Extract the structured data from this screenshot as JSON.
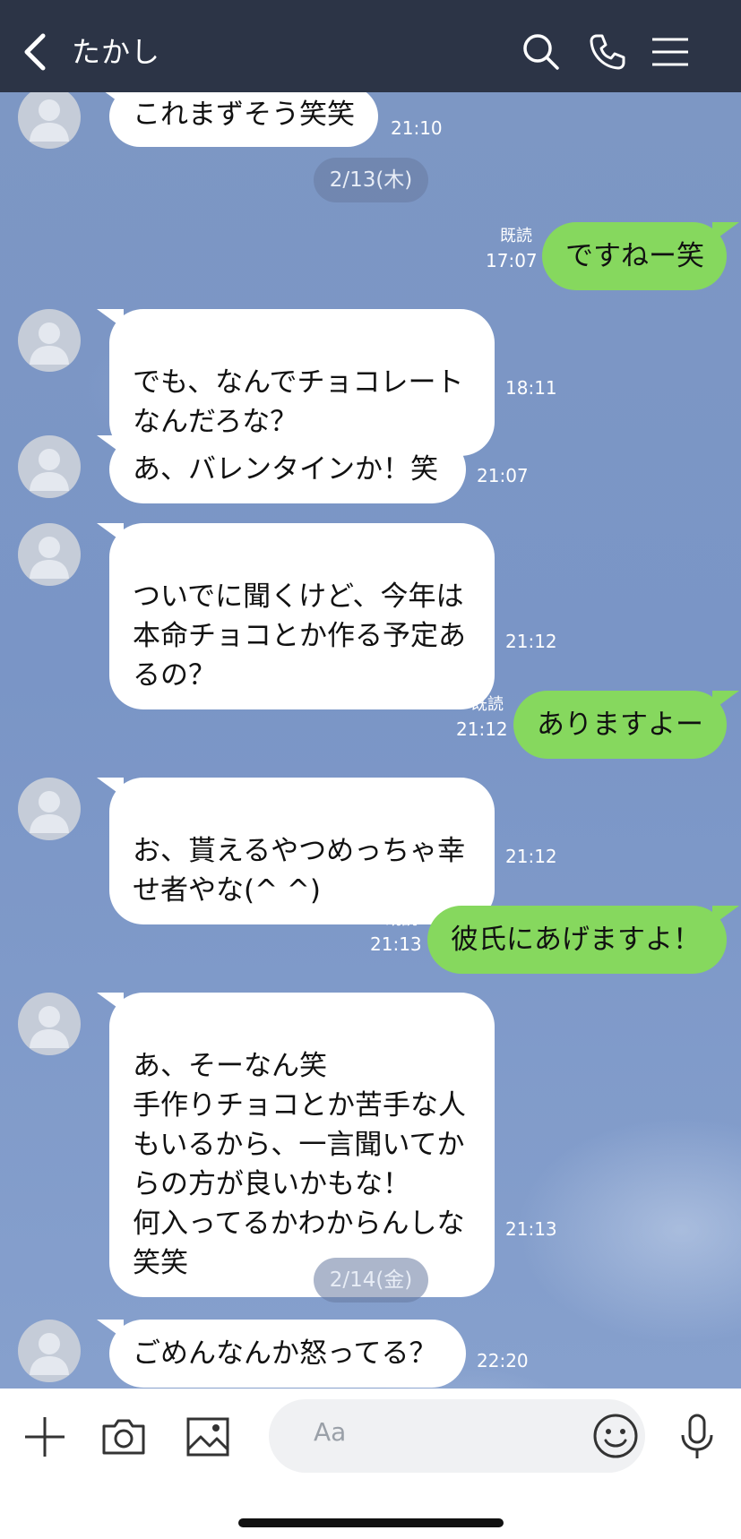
{
  "header": {
    "title": "たかし",
    "icons": [
      "back-icon",
      "search-icon",
      "phone-icon",
      "menu-icon"
    ]
  },
  "messages": [
    {
      "dir": "in",
      "text": "これまずそう笑笑",
      "time": "21:10"
    },
    {
      "dir": "out",
      "text": "ですねー笑",
      "time": "17:07",
      "read": "既読"
    },
    {
      "dir": "in",
      "text": "でも、なんでチョコレート\nなんだろな？",
      "time": "18:11"
    },
    {
      "dir": "in",
      "text": "あ、バレンタインか！笑",
      "time": "21:07"
    },
    {
      "dir": "in",
      "text": "ついでに聞くけど、今年は\n本命チョコとか作る予定あ\nるの？",
      "time": "21:12"
    },
    {
      "dir": "out",
      "text": "ありますよー",
      "time": "21:12",
      "read": "既読"
    },
    {
      "dir": "in",
      "text": "お、貰えるやつめっちゃ幸\nせ者やな(^ ^)",
      "time": "21:12"
    },
    {
      "dir": "out",
      "text": "彼氏にあげますよ！",
      "time": "21:13",
      "read": "既読"
    },
    {
      "dir": "in",
      "text": "あ、そーなん笑\n手作りチョコとか苦手な人\nもいるから、一言聞いてか\nらの方が良いかもな！\n何入ってるかわからんしな\n笑笑",
      "time": "21:13"
    },
    {
      "dir": "in",
      "text": "ごめんなんか怒ってる？",
      "time": "22:20"
    }
  ],
  "dates": [
    "2/13(木)",
    "2/14(金)"
  ],
  "footer": {
    "input_placeholder": "Aa",
    "icons": [
      "plus-icon",
      "camera-icon",
      "image-icon",
      "emoji-icon",
      "mic-icon"
    ]
  },
  "colors": {
    "header_bg": "#2c3446",
    "chat_bg": "#7d97c4",
    "outgoing_bubble": "#86d85e",
    "incoming_bubble": "#ffffff"
  }
}
